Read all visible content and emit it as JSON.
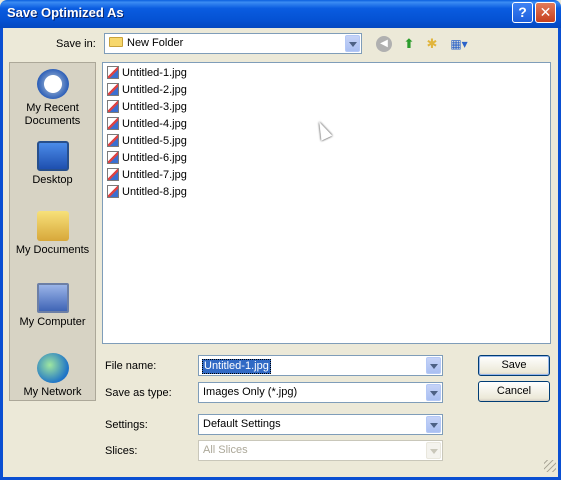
{
  "window": {
    "title": "Save Optimized As"
  },
  "titlebar": {
    "help_label": "?",
    "close_label": "✕"
  },
  "savein": {
    "label": "Save in:",
    "value": "New Folder"
  },
  "toolbar": {
    "back_glyph": "◀",
    "up_glyph": "⬆",
    "newfolder_glyph": "✱",
    "views_glyph": "▦▾"
  },
  "places": [
    {
      "label": "My Recent Documents",
      "icon": "recent-documents-icon"
    },
    {
      "label": "Desktop",
      "icon": "desktop-icon"
    },
    {
      "label": "My Documents",
      "icon": "my-documents-icon"
    },
    {
      "label": "My Computer",
      "icon": "my-computer-icon"
    },
    {
      "label": "My Network",
      "icon": "my-network-icon"
    }
  ],
  "files": [
    "Untitled-1.jpg",
    "Untitled-2.jpg",
    "Untitled-3.jpg",
    "Untitled-4.jpg",
    "Untitled-5.jpg",
    "Untitled-6.jpg",
    "Untitled-7.jpg",
    "Untitled-8.jpg"
  ],
  "form": {
    "filename_label": "File name:",
    "filename_value": "Untitled-1.jpg",
    "savetype_label": "Save as type:",
    "savetype_value": "Images Only (*.jpg)",
    "settings_label": "Settings:",
    "settings_value": "Default Settings",
    "slices_label": "Slices:",
    "slices_value": "All Slices"
  },
  "buttons": {
    "save": "Save",
    "cancel": "Cancel"
  },
  "colors": {
    "titlebar": "#0a5ce0",
    "selection": "#316ac5",
    "face": "#ece9d8"
  }
}
